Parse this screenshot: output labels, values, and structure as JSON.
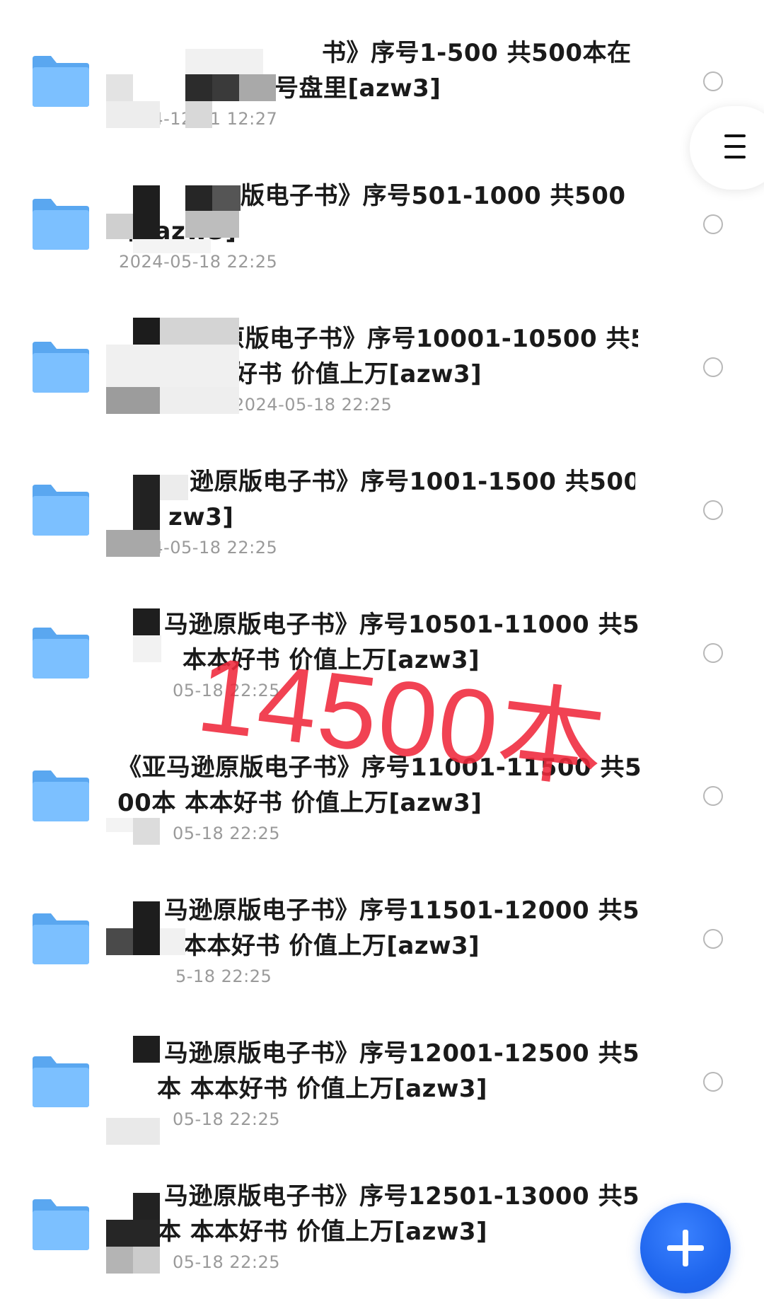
{
  "colors": {
    "folder_back": "#5aa7f0",
    "folder_front": "#7cc0ff",
    "title_text": "#1a1a1a",
    "date_text": "#9a9a9a",
    "radio_border": "#b8b8b8",
    "watermark": "#f0293c",
    "fab": "#1f66ee"
  },
  "icons": {
    "folder": "folder-icon",
    "menu": "menu-icon",
    "add": "plus-icon"
  },
  "watermark": {
    "text": "14500本"
  },
  "files": [
    {
      "title_line1": "书》序号1-500 共500本在",
      "title_line2": "号盘里[azw3]",
      "date": "2024-12-21 12:27"
    },
    {
      "title_line1": "版电子书》序号501-1000 共500",
      "title_line2": "本[azw3]",
      "date": "2024-05-18 22:25"
    },
    {
      "title_line1": "原版电子书》序号10001-10500 共5",
      "title_line2": "好书 价值上万[azw3]",
      "date": "2024-05-18 22:25"
    },
    {
      "title_line1": "逊原版电子书》序号1001-1500 共500",
      "title_line2": "zw3]",
      "date": "2024-05-18 22:25"
    },
    {
      "title_line1": "马逊原版电子书》序号10501-11000 共5",
      "title_line2": "本本好书 价值上万[azw3]",
      "date": "05-18 22:25"
    },
    {
      "title_line1": "《亚马逊原版电子书》序号11001-11500 共5",
      "title_line2": "00本 本本好书 价值上万[azw3]",
      "date": "05-18 22:25"
    },
    {
      "title_line1": "马逊原版电子书》序号11501-12000 共5",
      "title_line2": "本本好书 价值上万[azw3]",
      "date": "5-18 22:25"
    },
    {
      "title_line1": "马逊原版电子书》序号12001-12500 共5",
      "title_line2": "本 本本好书 价值上万[azw3]",
      "date": "05-18 22:25"
    },
    {
      "title_line1": "马逊原版电子书》序号12501-13000 共5",
      "title_line2": "本 本本好书 价值上万[azw3]",
      "date": "05-18 22:25"
    }
  ]
}
